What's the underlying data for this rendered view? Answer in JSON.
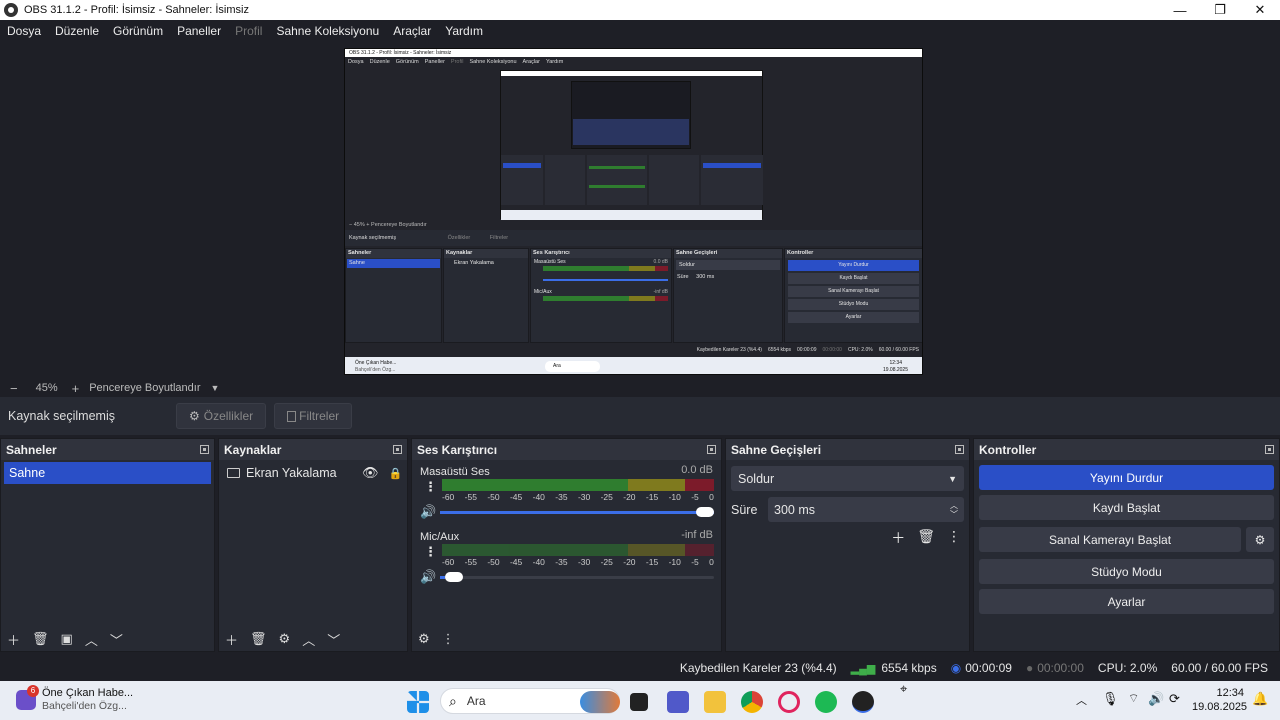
{
  "window": {
    "title": "OBS 31.1.2 - Profil: İsimsiz - Sahneler: İsimsiz"
  },
  "menu": [
    "Dosya",
    "Düzenle",
    "Görünüm",
    "Paneller",
    "Profil",
    "Sahne Koleksiyonu",
    "Araçlar",
    "Yardım"
  ],
  "zoom": {
    "minus": "−",
    "value": "45%",
    "plus": "+",
    "fit": "Pencereye Boyutlandır"
  },
  "source_bar": {
    "status": "Kaynak seçilmemiş",
    "properties": "Özellikler",
    "filters": "Filtreler"
  },
  "scenes": {
    "title": "Sahneler",
    "items": [
      "Sahne"
    ]
  },
  "sources": {
    "title": "Kaynaklar",
    "items": [
      "Ekran Yakalama"
    ]
  },
  "mixer": {
    "title": "Ses Karıştırıcı",
    "ticks": [
      "-60",
      "-55",
      "-50",
      "-45",
      "-40",
      "-35",
      "-30",
      "-25",
      "-20",
      "-15",
      "-10",
      "-5",
      "0"
    ],
    "channels": [
      {
        "name": "Masaüstü Ses",
        "db": "0.0 dB",
        "volume": 1.0,
        "meter_level": 1.0
      },
      {
        "name": "Mic/Aux",
        "db": "-inf dB",
        "volume": 0.02,
        "meter_level": 0.0
      }
    ]
  },
  "transitions": {
    "title": "Sahne Geçişleri",
    "selected": "Soldur",
    "duration_label": "Süre",
    "duration_value": "300 ms"
  },
  "controls": {
    "title": "Kontroller",
    "buttons": [
      "Yayını Durdur",
      "Kaydı Başlat",
      "Sanal Kamerayı Başlat",
      "Stüdyo Modu",
      "Ayarlar"
    ]
  },
  "status": {
    "dropped": "Kaybedilen Kareler 23 (%4.4)",
    "bitrate": "6554 kbps",
    "stream_time": "00:00:09",
    "record_time": "00:00:00",
    "cpu": "CPU: 2.0%",
    "fps": "60.00 / 60.00 FPS"
  },
  "taskbar": {
    "news_badge": "6",
    "news_title": "Öne Çıkan Habe...",
    "news_sub": "Bahçeli'den Özg...",
    "search": "Ara",
    "time": "12:34",
    "date": "19.08.2025"
  },
  "nested_preview": {
    "title": "OBS 31.1.2 - Profil: İsimsiz - Sahneler: İsimsiz",
    "menu": [
      "Dosya",
      "Düzenle",
      "Görünüm",
      "Paneller",
      "Profil",
      "Sahne Koleksiyonu",
      "Araçlar",
      "Yardım"
    ],
    "zoom": "45%",
    "fit": "Pencereye Boyutlandır",
    "status": "Kaynak seçilmemiş",
    "properties": "Özellikler",
    "filters": "Filtreler",
    "docks": [
      "Sahneler",
      "Kaynaklar",
      "Ses Karıştırıcı",
      "Sahne Geçişleri",
      "Kontroller"
    ],
    "scene": "Sahne",
    "source": "Ekran Yakalama",
    "mix1": "Masaüstü Ses",
    "mix1_db": "0.0 dB",
    "mix2": "Mic/Aux",
    "mix2_db": "-inf dB",
    "transition": "Soldur",
    "duration": "Süre",
    "duration_value": "300 ms",
    "buttons": [
      "Yayını Durdur",
      "Kaydı Başlat",
      "Sanal Kamerayı Başlat",
      "Stüdyo Modu",
      "Ayarlar"
    ],
    "statusbar": [
      "Kaybedilen Kareler 23 (%4.4)",
      "6554 kbps",
      "00:00:09",
      "00:00:00",
      "CPU: 2.0%",
      "60.00 / 60.00 FPS"
    ],
    "task_news": "Öne Çıkan Habe...",
    "task_news_sub": "Bahçeli'den Özg...",
    "task_search": "Ara",
    "task_time": "12:34",
    "task_date": "19.08.2025"
  }
}
